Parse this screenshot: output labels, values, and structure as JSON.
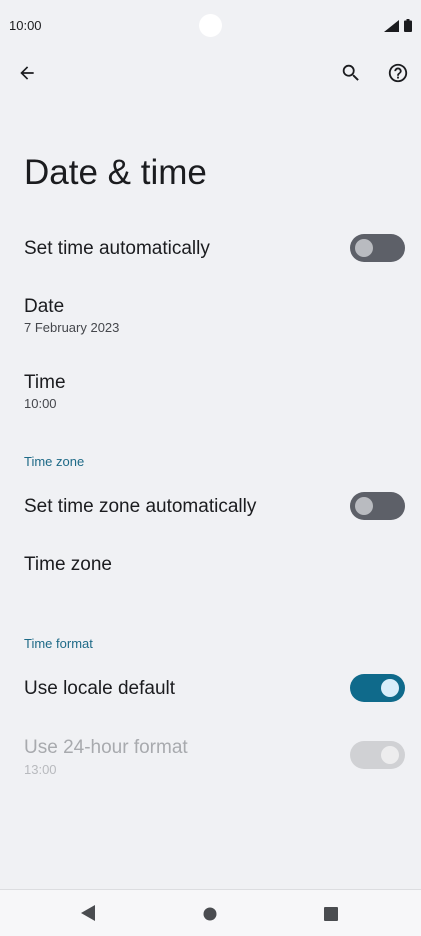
{
  "status_bar": {
    "time": "10:00",
    "icons": [
      "signal-icon",
      "battery-icon"
    ]
  },
  "toolbar": {
    "back_icon": "arrow-back-icon",
    "search_icon": "search-icon",
    "help_icon": "help-icon"
  },
  "page": {
    "title": "Date & time"
  },
  "settings": {
    "set_time_automatically": {
      "title": "Set time automatically",
      "enabled": false
    },
    "date": {
      "title": "Date",
      "summary": "7 February 2023"
    },
    "time": {
      "title": "Time",
      "summary": "10:00"
    },
    "time_zone_section": {
      "header": "Time zone"
    },
    "set_time_zone_automatically": {
      "title": "Set time zone automatically",
      "enabled": false
    },
    "time_zone": {
      "title": "Time zone"
    },
    "time_format_section": {
      "header": "Time format"
    },
    "use_locale_default": {
      "title": "Use locale default",
      "enabled": true
    },
    "use_24_hour_format": {
      "title": "Use 24-hour format",
      "summary": "13:00",
      "enabled": true,
      "disabled": true
    }
  },
  "colors": {
    "accent": "#0f6a8b",
    "section_header": "#1e6a87",
    "background": "#f0f1f4"
  },
  "nav_bar": {
    "icons": [
      "nav-back-icon",
      "nav-home-icon",
      "nav-recents-icon"
    ]
  }
}
